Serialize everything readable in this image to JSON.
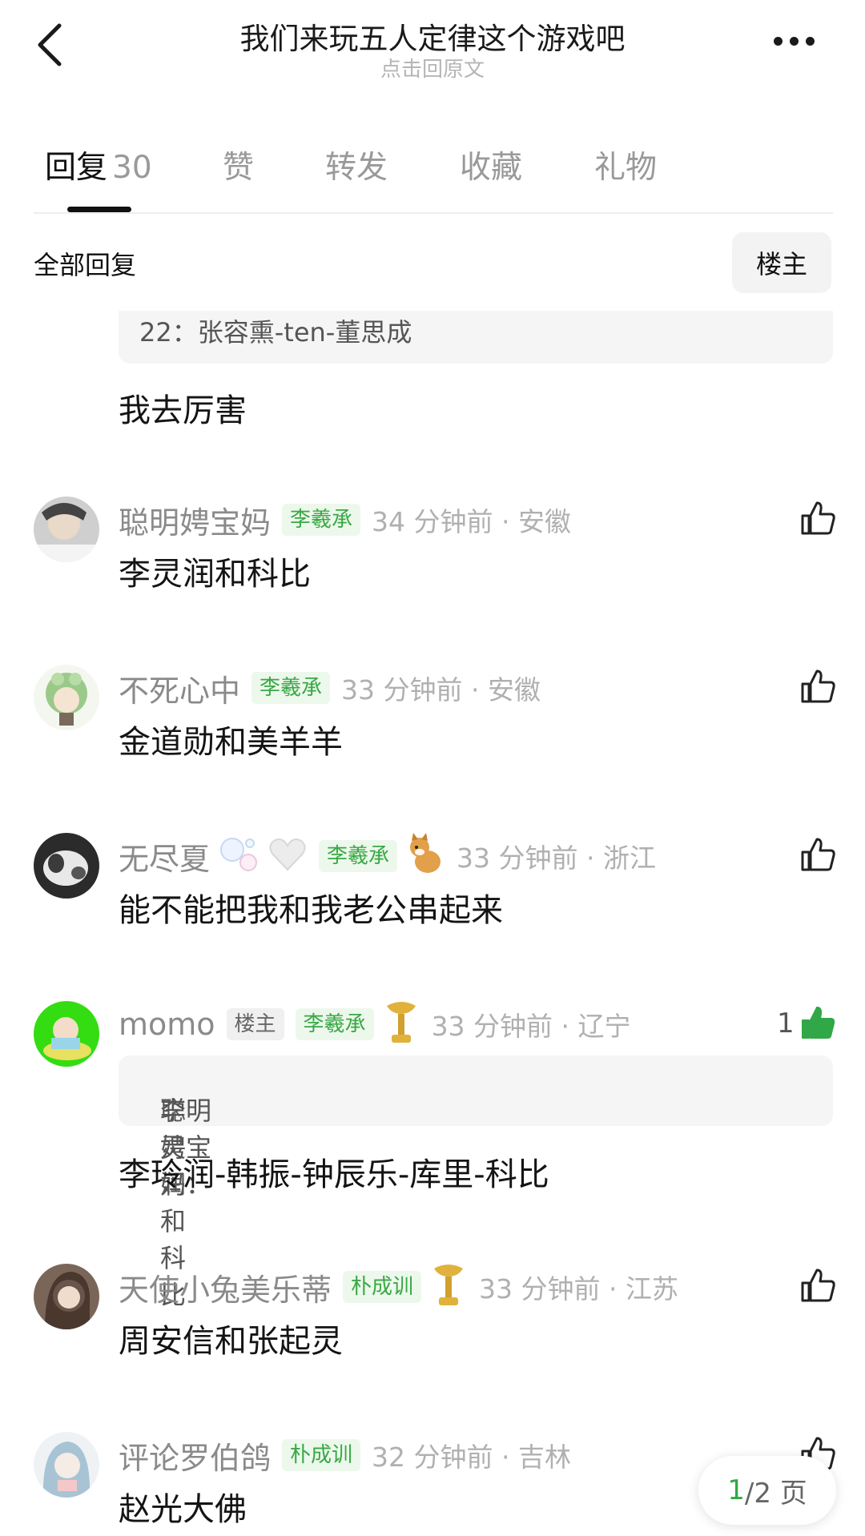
{
  "header": {
    "title": "我们来玩五人定律这个游戏吧",
    "subtitle": "点击回原文"
  },
  "tabs": [
    {
      "label": "回复",
      "count": "30",
      "active": true
    },
    {
      "label": "赞"
    },
    {
      "label": "转发"
    },
    {
      "label": "收藏"
    },
    {
      "label": "礼物"
    }
  ],
  "filter": {
    "label": "全部回复",
    "owner_button": "楼主"
  },
  "top_reply": {
    "quote": "22：张容熏-ten-董思成",
    "body": "我去厉害"
  },
  "comments": [
    {
      "username": "聪明娉宝妈",
      "tag": "李羲承",
      "time": "34 分钟前 · 安徽",
      "body": "李灵润和科比"
    },
    {
      "username": "不死心中",
      "tag": "李羲承",
      "time": "33 分钟前 · 安徽",
      "body": "金道勋和美羊羊"
    },
    {
      "username": "无尽夏",
      "tag": "李羲承",
      "time": "33 分钟前 · 浙江",
      "body": "能不能把我和我老公串起来"
    },
    {
      "username": "momo",
      "owner_tag": "楼主",
      "tag": "李羲承",
      "time": "33 分钟前 · 辽宁",
      "likes": "1",
      "quote_user": "聪明娉宝妈：",
      "quote_text": "李灵润和科比",
      "body": "李玲润-韩振-钟辰乐-库里-科比"
    },
    {
      "username": "天使小兔美乐蒂",
      "tag": "朴成训",
      "time": "33 分钟前 · 江苏",
      "body": "周安信和张起灵"
    },
    {
      "username": "评论罗伯鸽",
      "tag": "朴成训",
      "time": "32 分钟前 · 吉林",
      "body": "赵光大佛"
    }
  ],
  "pager": {
    "current": "1",
    "total": "/2 页"
  },
  "colors": {
    "accent_green": "#31a847",
    "tag_bg": "#ecf8ec"
  }
}
